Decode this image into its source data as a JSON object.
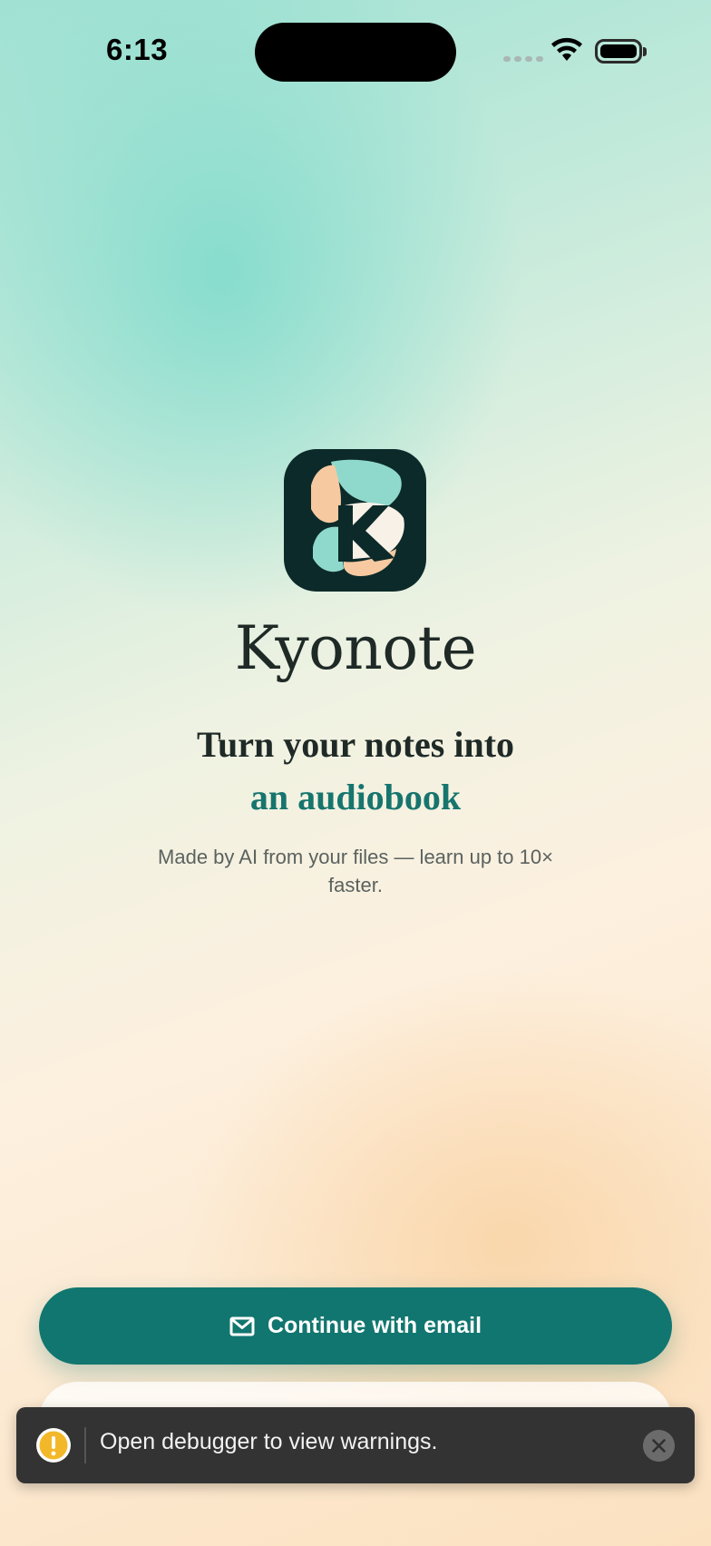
{
  "status_bar": {
    "time": "6:13"
  },
  "app": {
    "name": "Kyonote",
    "headline_line1": "Turn your notes into",
    "headline_line2": "an audiobook",
    "tagline": "Made by AI from your files — learn up to 10× faster.",
    "accent_color": "#16756e"
  },
  "actions": {
    "email_label": "Continue with email",
    "email_icon": "envelope-icon",
    "button_color": "#11766f"
  },
  "debugger_toast": {
    "message": "Open debugger to view warnings.",
    "icon": "warning-icon",
    "close_icon": "close-icon"
  }
}
